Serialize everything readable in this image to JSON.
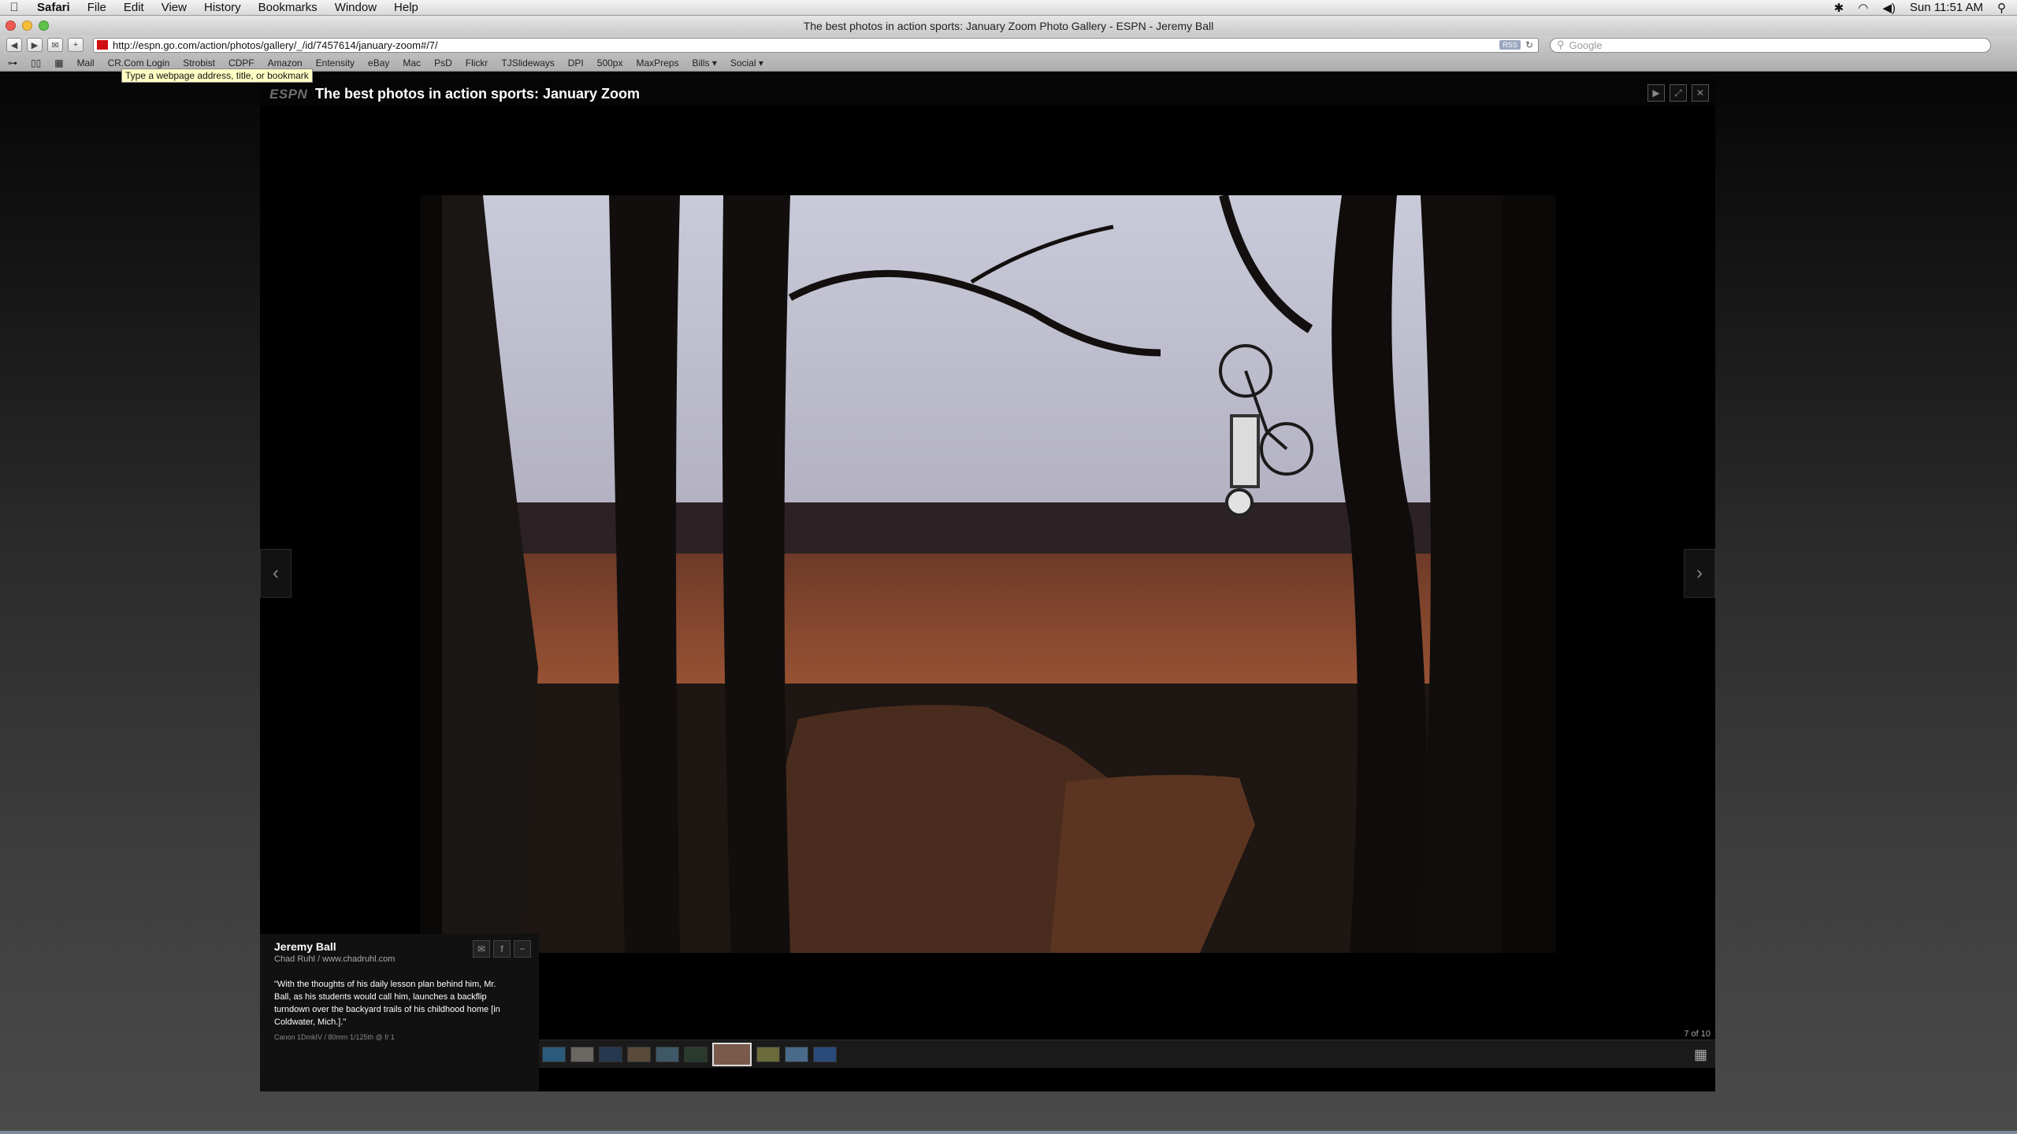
{
  "menubar": {
    "app": "Safari",
    "items": [
      "File",
      "Edit",
      "View",
      "History",
      "Bookmarks",
      "Window",
      "Help"
    ],
    "clock": "Sun 11:51 AM"
  },
  "window": {
    "title": "The best photos in action sports: January Zoom Photo Gallery - ESPN - Jeremy Ball"
  },
  "toolbar": {
    "url": "http://espn.go.com/action/photos/gallery/_/id/7457614/january-zoom#/7/",
    "rss": "RSS",
    "search_placeholder": "Google"
  },
  "bookmarks": [
    "Mail",
    "CR.Com Login",
    "Strobist",
    "CDPF",
    "Amazon",
    "Entensity",
    "eBay",
    "Mac",
    "PsD",
    "Flickr",
    "TJSlideways",
    "DPI",
    "500px",
    "MaxPreps",
    "Bills ▾",
    "Social ▾"
  ],
  "tooltip": "Type a webpage address, title, or bookmark",
  "gallery": {
    "logo": "ESPN",
    "title": "The best photos in action sports: January Zoom",
    "counter": "7 of 10",
    "active_index": 7,
    "total": 10
  },
  "caption": {
    "name": "Jeremy Ball",
    "credit": "Chad Ruhl / www.chadruhl.com",
    "text": "\"With the thoughts of his daily lesson plan behind him, Mr. Ball, as his students would call him, launches a backflip turndown over the backyard trails of his childhood home [in Coldwater, Mich.].\"",
    "camera": "Canon 1DmkIV / 80mm 1/125th @ f/ 1"
  },
  "icons": {
    "prev": "‹",
    "next": "›",
    "play": "▶",
    "fullscreen": "⤢",
    "close": "✕",
    "email": "✉",
    "facebook": "f",
    "minimize": "−",
    "grid": "▦"
  },
  "colors": {
    "espn_red": "#d01010",
    "page_black": "#000000"
  }
}
